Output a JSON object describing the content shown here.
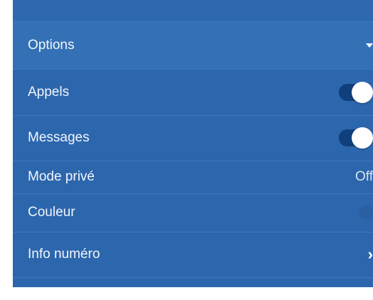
{
  "settings": {
    "header": {
      "label": "Options",
      "icon": "caret-down-icon"
    },
    "calls": {
      "label": "Appels",
      "enabled": true
    },
    "messages": {
      "label": "Messages",
      "enabled": true
    },
    "private_mode": {
      "label": "Mode privé",
      "value": "Off"
    },
    "color": {
      "label": "Couleur"
    },
    "number_info": {
      "label": "Info numéro",
      "icon": "chevron-right-icon",
      "chevron": "›"
    }
  },
  "colors": {
    "panel": "#2c66ad",
    "header": "#3470b5",
    "toggle_track": "#0f3f7c",
    "knob": "#ffffff",
    "text": "#f2f6fb"
  }
}
